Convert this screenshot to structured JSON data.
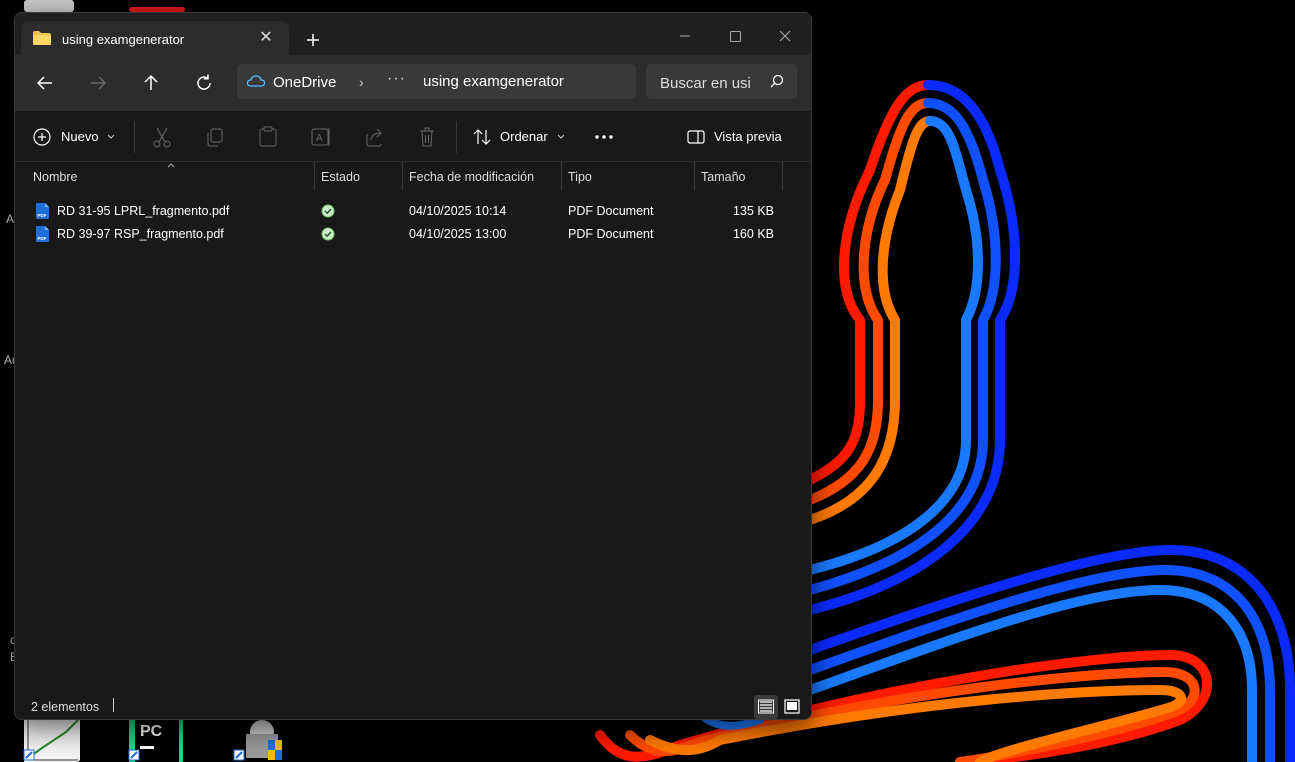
{
  "window": {
    "tab_title": "using examgenerator"
  },
  "navigation": {
    "location_root": "OneDrive",
    "overflow": "···",
    "current_folder": "using examgenerator",
    "search_placeholder": "Buscar en usi"
  },
  "command_bar": {
    "new_label": "Nuevo",
    "sort_label": "Ordenar",
    "preview_label": "Vista previa"
  },
  "columns": {
    "name": "Nombre",
    "status": "Estado",
    "modified": "Fecha de modificación",
    "type": "Tipo",
    "size": "Tamaño"
  },
  "files": [
    {
      "name": "RD 31-95 LPRL_fragmento.pdf",
      "modified": "04/10/2025 10:14",
      "type": "PDF Document",
      "size": "135 KB",
      "status_icon": "synced-check-icon"
    },
    {
      "name": "RD 39-97 RSP_fragmento.pdf",
      "modified": "04/10/2025 13:00",
      "type": "PDF Document",
      "size": "160 KB",
      "status_icon": "synced-check-icon"
    }
  ],
  "status_bar": {
    "item_count": "2 elementos"
  },
  "desktop_fragments": [
    "A",
    "Au",
    "c",
    "E"
  ],
  "colors": {
    "accent": "#4cc2ff",
    "synced": "#6ccb5f",
    "pdf_icon": "#1e6fd9",
    "wallpaper_red": "#ff1a00",
    "wallpaper_orange": "#ff7a00",
    "wallpaper_blue": "#0a2aff",
    "wallpaper_lightblue": "#1a7aff"
  }
}
